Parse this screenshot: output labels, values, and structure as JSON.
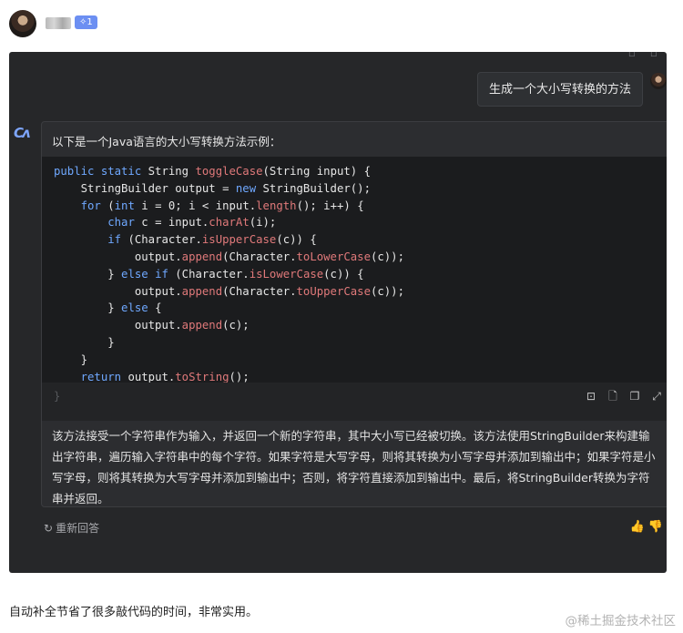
{
  "header": {
    "level_badge": "✧1"
  },
  "chat": {
    "user_message": "生成一个大小写转换的方法",
    "ai_intro": "以下是一个Java语言的大小写转换方法示例：",
    "code_lines": [
      "public static String toggleCase(String input) {",
      "    StringBuilder output = new StringBuilder();",
      "    for (int i = 0; i < input.length(); i++) {",
      "        char c = input.charAt(i);",
      "        if (Character.isUpperCase(c)) {",
      "            output.append(Character.toLowerCase(c));",
      "        } else if (Character.isLowerCase(c)) {",
      "            output.append(Character.toUpperCase(c));",
      "        } else {",
      "            output.append(c);",
      "        }",
      "    }",
      "    return output.toString();"
    ],
    "code_trailing_brace": "}",
    "ai_explanation": "该方法接受一个字符串作为输入，并返回一个新的字符串，其中大小写已经被切换。该方法使用StringBuilder来构建输出字符串，遍历输入字符串中的每个字符。如果字符是大写字母，则将其转换为小写字母并添加到输出中；如果字符是小写字母，则将其转换为大写字母并添加到输出中；否则，将字符直接添加到输出中。最后，将StringBuilder转换为字符串并返回。",
    "regenerate_label": "重新回答"
  },
  "post": {
    "comment": "自动补全节省了很多敲代码的时间，非常实用。",
    "watermark": "@稀土掘金技术社区"
  },
  "icons": [
    "avatar",
    "ai-logo-icon",
    "insert-code-icon",
    "new-file-icon",
    "copy-icon",
    "expand-icon",
    "refresh-icon",
    "thumb-up-icon",
    "thumb-down-icon"
  ]
}
